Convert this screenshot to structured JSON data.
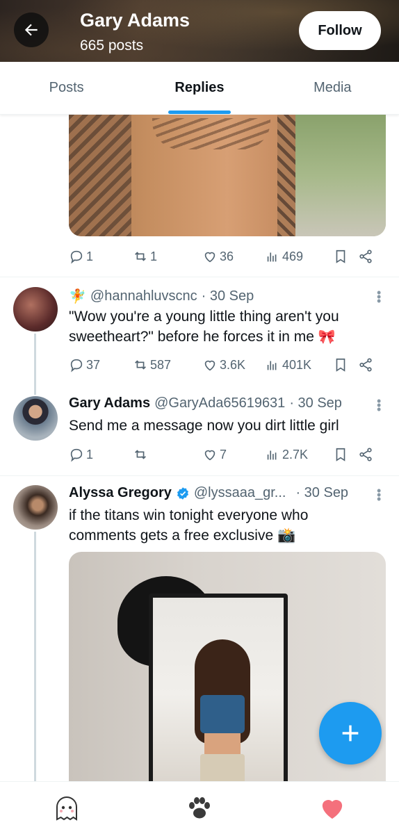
{
  "header": {
    "title": "Gary Adams",
    "posts_count": "665 posts",
    "follow_label": "Follow",
    "back_icon": "arrow-left-icon"
  },
  "tabs": [
    {
      "label": "Posts",
      "active": false
    },
    {
      "label": "Replies",
      "active": true
    },
    {
      "label": "Media",
      "active": false
    }
  ],
  "top_post": {
    "actions": {
      "replies": "1",
      "reposts": "1",
      "likes": "36",
      "views": "469"
    }
  },
  "tweets": [
    {
      "emoji": "🧚",
      "handle": "@hannahluvscnc",
      "date": "· 30 Sep",
      "text": "\"Wow you're a young little thing aren't you sweetheart?\" before he forces it in me",
      "text_emoji": "🎀",
      "actions": {
        "replies": "37",
        "reposts": "587",
        "likes": "3.6K",
        "views": "401K"
      }
    },
    {
      "name": "Gary Adams",
      "handle": "@GaryAda65619631",
      "date": "· 30 Sep",
      "text": "Send me a message now you dirt little girl",
      "actions": {
        "replies": "1",
        "reposts": "",
        "likes": "7",
        "views": "2.7K"
      }
    },
    {
      "name": "Alyssa Gregory",
      "verified": true,
      "handle": "@lyssaaa_gr...",
      "date": "· 30 Sep",
      "text": "if the titans win tonight everyone who comments gets a free exclusive",
      "text_emoji": "📸"
    }
  ],
  "bottom_nav": [
    {
      "icon": "ghost-icon"
    },
    {
      "icon": "paw-icon"
    },
    {
      "icon": "heart-icon"
    }
  ],
  "colors": {
    "accent": "#1d9bf0",
    "heart": "#f4707c"
  }
}
